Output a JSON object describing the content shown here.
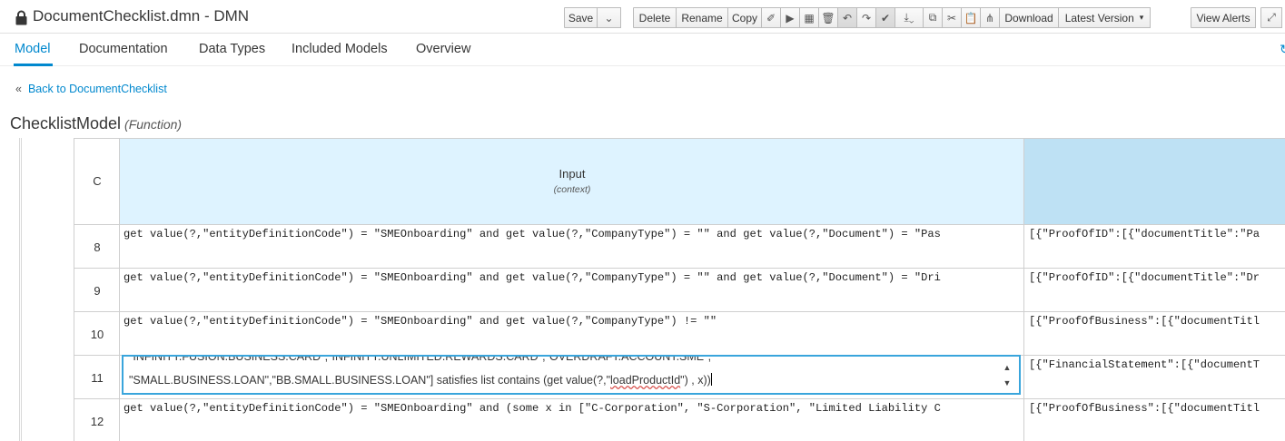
{
  "window": {
    "title": "DocumentChecklist.dmn - DMN"
  },
  "toolbar": {
    "save": "Save",
    "delete": "Delete",
    "rename": "Rename",
    "copy": "Copy",
    "download": "Download",
    "latest_version": "Latest Version",
    "view_alerts": "View Alerts",
    "icons": [
      "caret-down-icon",
      "eraser-icon",
      "play-icon",
      "grid-icon",
      "trash-icon",
      "undo-icon",
      "redo-icon",
      "check-icon",
      "export-icon",
      "copy-icon",
      "cut-icon",
      "paste-icon",
      "hierarchy-icon",
      "expand-icon"
    ]
  },
  "tabs": [
    {
      "label": "Model",
      "active": true
    },
    {
      "label": "Documentation",
      "active": false
    },
    {
      "label": "Data Types",
      "active": false
    },
    {
      "label": "Included Models",
      "active": false
    },
    {
      "label": "Overview",
      "active": false
    }
  ],
  "back_link": "Back to DocumentChecklist",
  "back_arrow": "«",
  "model": {
    "name": "ChecklistModel",
    "kind": "(Function)"
  },
  "table": {
    "hit_policy": "C",
    "input_header": "Input",
    "input_sub": "(context)",
    "rows": [
      {
        "num": "8",
        "input": "get value(?,\"entityDefinitionCode\") = \"SMEOnboarding\" and get value(?,\"CompanyType\") = \"\" and get value(?,\"Document\") = \"Pas",
        "output": "[{\"ProofOfID\":[{\"documentTitle\":\"Pa"
      },
      {
        "num": "9",
        "input": "get value(?,\"entityDefinitionCode\") = \"SMEOnboarding\" and get value(?,\"CompanyType\") = \"\" and get value(?,\"Document\") = \"Dri",
        "output": "[{\"ProofOfID\":[{\"documentTitle\":\"Dr"
      },
      {
        "num": "10",
        "input": "get value(?,\"entityDefinitionCode\") = \"SMEOnboarding\" and get value(?,\"CompanyType\") != \"\"",
        "output": "[{\"ProofOfBusiness\":[{\"documentTitl"
      },
      {
        "num": "11",
        "input": "",
        "output": "[{\"FinancialStatement\":[{\"documentT"
      },
      {
        "num": "12",
        "input": "get value(?,\"entityDefinitionCode\") = \"SMEOnboarding\" and (some x in [\"C-Corporation\", \"S-Corporation\", \"Limited Liability C",
        "output": "[{\"ProofOfBusiness\":[{\"documentTitl"
      }
    ]
  },
  "editor": {
    "line1": "\"INFINITY.FUSION.BUSINESS.CARD\",\"INFINITY.UNLIMITED.REWARDS.CARD\",\"OVERDRAFT.ACCOUNT.SME\",",
    "line2_prefix": "\"SMALL.BUSINESS.LOAN\",\"BB.SMALL.BUSINESS.LOAN\"] satisfies list contains (get value(?,\"",
    "line2_word": "loadProductId",
    "line2_suffix": "\") , x))"
  }
}
